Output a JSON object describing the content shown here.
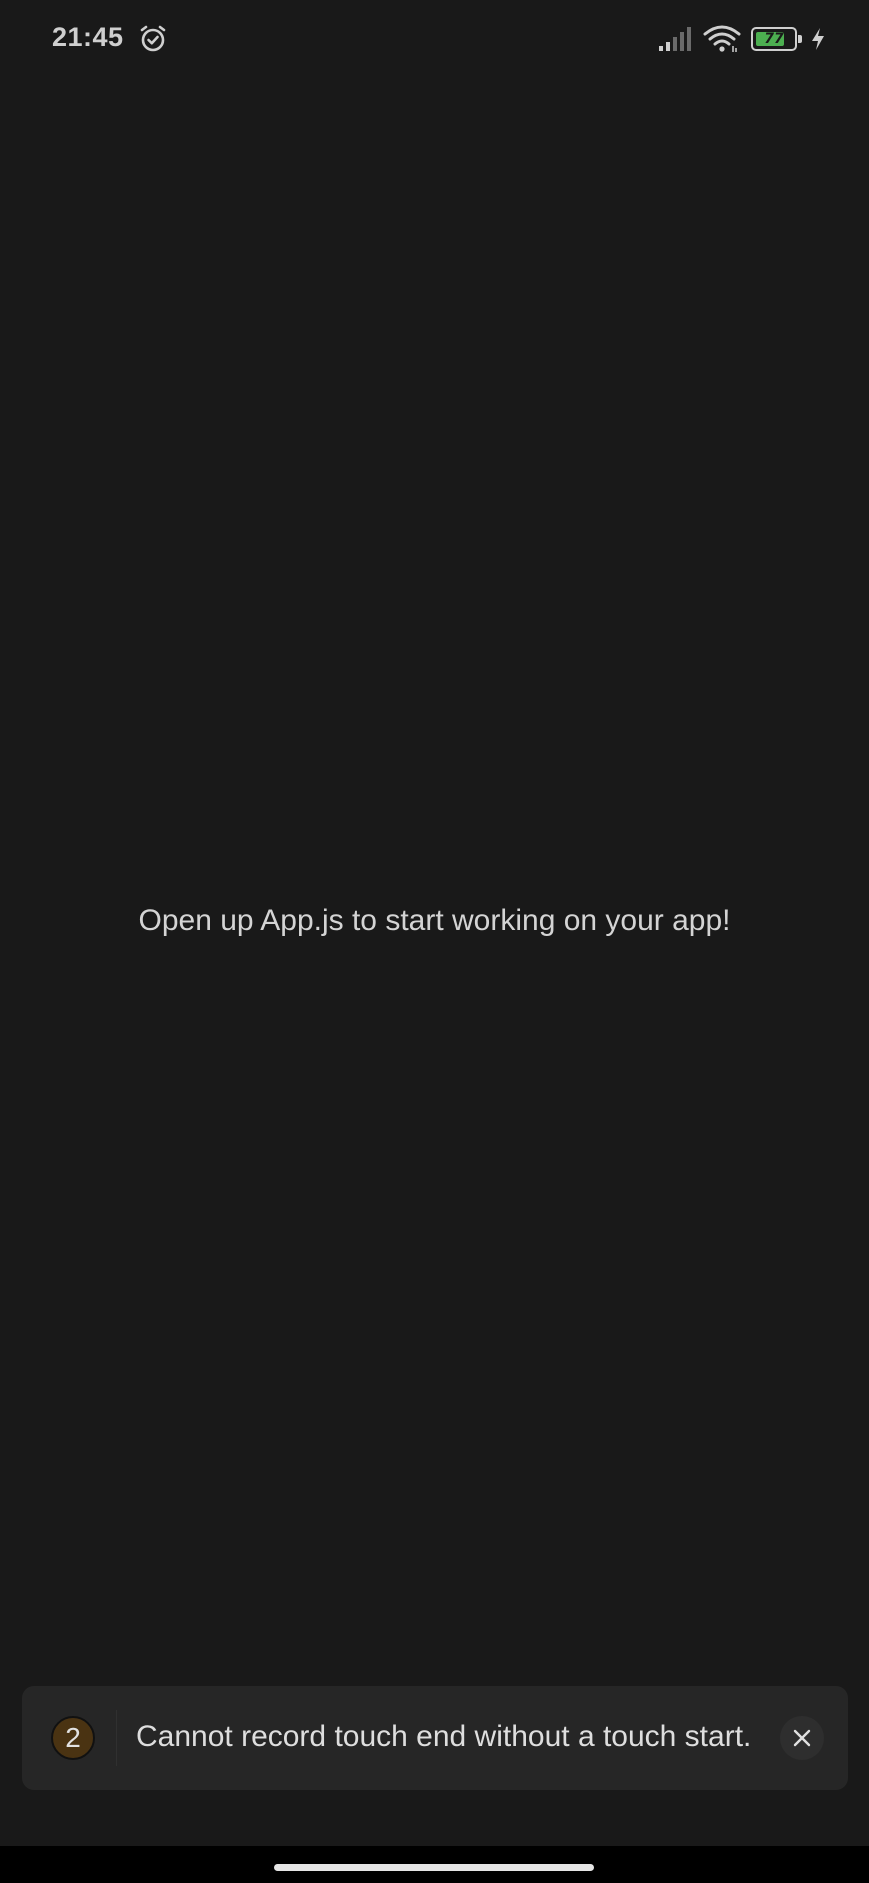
{
  "status_bar": {
    "time": "21:45",
    "battery_level": "77",
    "battery_fraction": 0.77,
    "icons": [
      "alarm-icon",
      "signal-icon",
      "wifi-icon",
      "battery-icon",
      "charging-icon"
    ]
  },
  "main": {
    "message": "Open up App.js to start working on your app!"
  },
  "toast": {
    "count": "2",
    "message": "Cannot record touch end without a touch start.",
    "close_icon": "close-icon"
  },
  "colors": {
    "background": "#191919",
    "battery_fill": "#4caf50",
    "toast_background": "#262626",
    "count_badge": "#4a3312"
  }
}
